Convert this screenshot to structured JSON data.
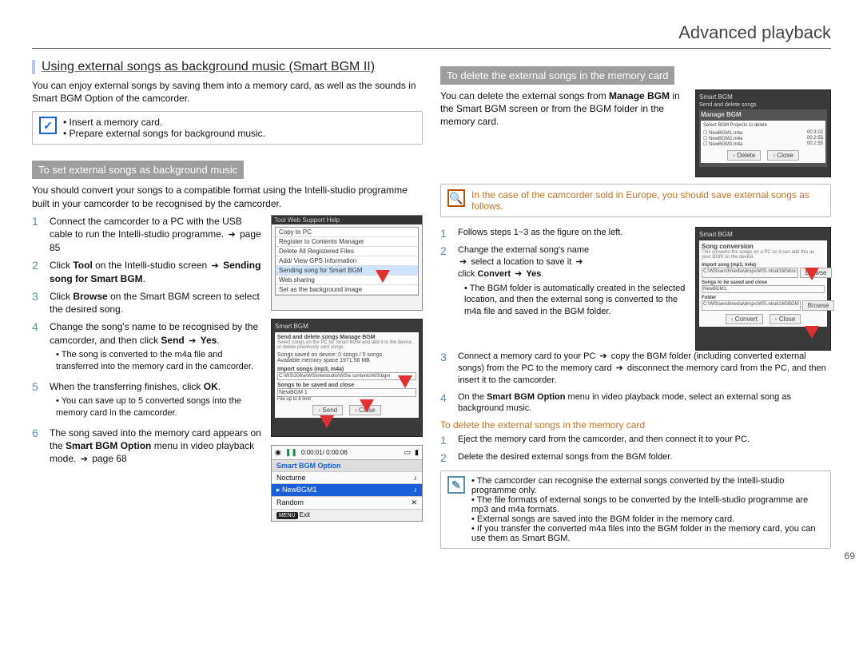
{
  "page": {
    "title": "Advanced playback",
    "number": "69"
  },
  "left": {
    "main_title": "Using external songs as background music (Smart BGM II)",
    "intro": "You can enjoy external songs by saving them into a memory card, as well as the sounds in Smart BGM Option of the camcorder.",
    "note1_a": "Insert a memory card.",
    "note1_b": "Prepare external songs for background music.",
    "section1": "To set external songs as background music",
    "section1_intro": "You should convert your songs to a compatible format using the Intelli-studio programme built in your camcorder to be recognised by the camcorder.",
    "steps": [
      {
        "n": "1",
        "body_a": "Connect the camcorder to a PC with the USB cable to run the Intelli-studio programme. ",
        "body_b": " page 85"
      },
      {
        "n": "2",
        "body_a": "Click ",
        "b1": "Tool",
        "body_b": " on the Intelli-studio screen ",
        "b2": "Sending song for Smart BGM",
        "body_c": "."
      },
      {
        "n": "3",
        "body_a": "Click ",
        "b1": "Browse",
        "body_b": " on the Smart BGM screen to select the desired song."
      },
      {
        "n": "4",
        "body_a": "Change the song's name to be recognised by the camcorder, and then click ",
        "b1": "Send",
        "body_b": " ",
        "b2": "Yes",
        "body_c": ".",
        "bullets": [
          "The song is converted to the m4a file and transferred into the memory card in the camcorder."
        ]
      },
      {
        "n": "5",
        "body_a": "When the transferring finishes, click ",
        "b1": "OK",
        "body_b": ".",
        "bullets": [
          "You can save up to 5 converted songs into the memory card in the camcorder."
        ]
      },
      {
        "n": "6",
        "body_a": "The song saved into the memory card appears on the ",
        "b1": "Smart BGM Option",
        "body_b": " menu in video playback mode. ",
        "body_c": " page 68"
      }
    ],
    "fig_tool": {
      "items": [
        "Copy to PC",
        "Register to Contents Manager",
        "Delete All Registered Files",
        "Add/ View GPS Information",
        "Sending song for Smart BGM",
        "Web sharing",
        "Set as the background image"
      ],
      "tabs": "Tool   Web Support   Help"
    },
    "fig_bgm": {
      "title": "Smart BGM",
      "sub": "Send and delete songs            Manage BGM",
      "line1": "Select songs on the PC for Smart BGM and add it to the device, or delete previously sent songs.",
      "row_songs": "Songs saved on device:          0 songs / 5 songs",
      "row_mem": "Available memory space          1971.56 MB",
      "import": "Import songs (mp3, m4a)",
      "path": "C:\\WS\\306\\e\\WS\\intelstudio\\WS\\e contents\\WS\\bgm",
      "rename": "Songs to be saved and close",
      "name": "NewBGM 1",
      "fsize": "File up to 8 limit",
      "btn_send": "Send",
      "btn_close": "Close"
    },
    "fig_play": {
      "time": "0:00:01/ 0:00:06",
      "header": "Smart BGM Option",
      "item1": "Nocturne",
      "item2": "NewBGM1",
      "item3": "Random",
      "exit": "Exit"
    }
  },
  "right": {
    "section1": "To delete the external songs in the memory card",
    "intro_a": "You can delete the external songs from ",
    "intro_b": "Manage BGM",
    "intro_c": " in the Smart BGM screen or from the BGM folder in the memory card.",
    "fig_manage": {
      "title": "Smart BGM",
      "sub": "Send and delete songs",
      "mgr": "Manage BGM",
      "line": "Select BGM Projects to delete",
      "rows": [
        {
          "name": "NewBGM1.m4a",
          "time": "00:3:02"
        },
        {
          "name": "NewBGM2.m4a",
          "time": "00:2:55"
        },
        {
          "name": "NewBGM3.m4a",
          "time": "00:2:55"
        }
      ],
      "btn_del": "Delete",
      "btn_close": "Close"
    },
    "note_orange": "In the case of the camcorder sold in Europe, you should save external songs as follows.",
    "rsteps": [
      {
        "n": "1",
        "body": "Follows steps 1~3 as the figure on the left."
      },
      {
        "n": "2",
        "body_a": "Change the external song's name ",
        "body_b": " select a location to save it ",
        "body_c": " click ",
        "b1": "Convert",
        "body_d": " ",
        "b2": "Yes",
        "body_e": ".",
        "bullets": [
          "The BGM folder is automatically created in the selected location, and then the external song is converted to the m4a file and saved in the BGM folder."
        ]
      },
      {
        "n": "3",
        "body_a": "Connect a memory card to your PC ",
        "body_b": " copy the BGM folder (including converted external songs) from the PC to the memory card ",
        "body_c": " disconnect the memory card from the PC, and then insert it to the camcorder."
      },
      {
        "n": "4",
        "body_a": "On the ",
        "b1": "Smart BGM Option",
        "body_b": " menu in video playback mode, select an external song as background music."
      }
    ],
    "fig_conv": {
      "title": "Smart BGM",
      "sub": "Song conversion",
      "line": "This converts the songs on a PC so it can add this as your BGM on the device.",
      "import": "Import song (mp3, m4a)",
      "path": "C:\\WS\\send\\media\\drops\\WS\\.ntrail160\\disc",
      "rename": "Songs to be saved and close",
      "name": "NewBGM1",
      "folder": "Folder",
      "fpath": "C:\\WS\\send\\media\\drops\\WS\\.ntrail160\\BGM",
      "btn1": "Convert",
      "btn2": "Close",
      "btn_browse": "Browse"
    },
    "del_link": "To delete the external songs in the memory card",
    "dsteps": [
      {
        "n": "1",
        "body": "Eject the memory card from the camcorder, and then connect it to your PC."
      },
      {
        "n": "2",
        "body": "Delete the desired external songs from the BGM folder."
      }
    ],
    "note_teal": {
      "a": "The camcorder can recognise the external songs converted by the Intelli-studio programme only.",
      "b": "The file formats of external songs to be converted by the Intelli-studio programme are mp3 and m4a formats.",
      "c": "External songs are saved into the BGM folder in the memory card.",
      "d": "If you transfer the converted m4a files into the BGM folder in the memory card, you can use them as Smart BGM."
    }
  }
}
